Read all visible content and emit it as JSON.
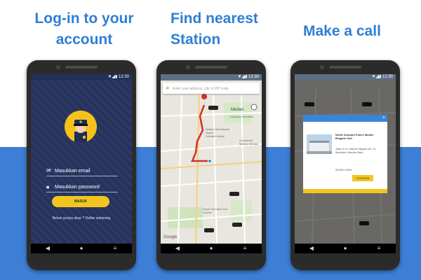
{
  "captions": {
    "login": "Log-in to your account",
    "find": "Find nearest Station",
    "call": "Make a call"
  },
  "status": {
    "time": "12:30"
  },
  "login_screen": {
    "email_placeholder": "Masukkan email",
    "password_placeholder": "Masukkan password",
    "button_label": "MASUK",
    "signup_text": "Belum punya akun ? Daftar sekarang"
  },
  "map_screen": {
    "search_placeholder": "Enter your address, city or ZIP code",
    "labels": {
      "medan": "Medan",
      "lapangan": "Lapangan Merdeka",
      "airport": "Bekas International Airport",
      "museum": "Sekolah Kartini",
      "military": "Soewondo Military Airbase",
      "golf": "Royal Sumatra Golf Course",
      "google": "Google"
    }
  },
  "call_screen": {
    "station_name": "North Sumatra Police Mobile Brigade Unit",
    "address": "Jalan K.H. Wahid Hasyim No. 3I, Merdeka, Medan Baru",
    "phone": "061821 3993",
    "call_button": "TELEPON"
  },
  "nav_icons": [
    "back-icon",
    "home-icon",
    "recents-icon"
  ],
  "colors": {
    "accent_blue": "#3d7fd6",
    "caption_blue": "#2f7fd3",
    "button_yellow": "#f2c61f",
    "login_bg": "#27345f"
  }
}
